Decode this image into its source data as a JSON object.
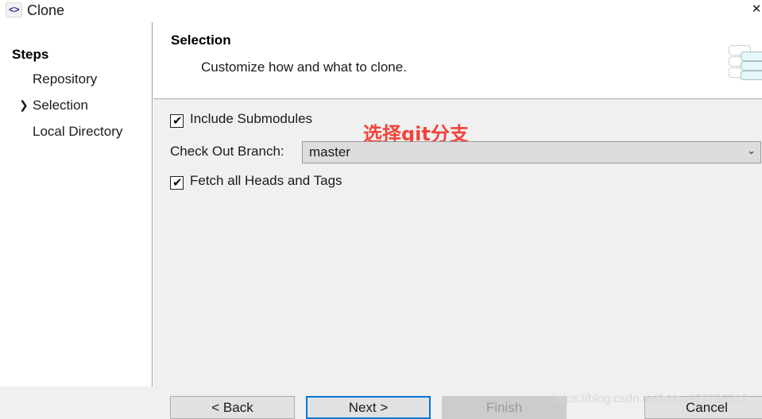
{
  "window": {
    "title": "Clone",
    "icon": "code-brackets-icon",
    "icon_glyph": "<>",
    "close_label": "✕"
  },
  "steps": {
    "heading": "Steps",
    "items": [
      {
        "label": "Repository",
        "current": false,
        "chevron": ""
      },
      {
        "label": "Selection",
        "current": true,
        "chevron": "❯"
      },
      {
        "label": "Local Directory",
        "current": false,
        "chevron": ""
      }
    ]
  },
  "header": {
    "title": "Selection",
    "subtitle": "Customize how and what to clone.",
    "decoration_icon": "git-branch-tree-icon"
  },
  "main": {
    "include_submodules": {
      "label": "Include Submodules",
      "checked": true,
      "check_glyph": "✔"
    },
    "fetch_all": {
      "label": "Fetch all Heads and Tags",
      "checked": true,
      "check_glyph": "✔"
    },
    "branch": {
      "label": "Check Out Branch:",
      "value": "master",
      "arrow_glyph": "⌄",
      "options": [
        "master"
      ]
    },
    "annotation": {
      "text": "选择git分支",
      "color": "#f4433a"
    }
  },
  "footer": {
    "buttons": [
      {
        "label": "< Back",
        "state": "enabled"
      },
      {
        "label": "Next >",
        "state": "focused"
      },
      {
        "label": "Finish",
        "state": "disabled"
      },
      {
        "label": "Cancel",
        "state": "enabled"
      }
    ]
  },
  "watermark": {
    "text": "https://blog.csdn.net/zhou920786312"
  },
  "colors": {
    "accent": "#0078d7",
    "annotation_red": "#f4433a",
    "panel_bg": "#f0f0f0",
    "icon_navy": "#2f3592"
  }
}
